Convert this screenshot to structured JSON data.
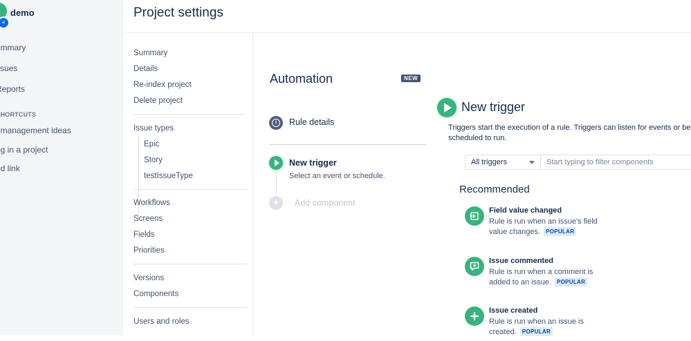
{
  "project": {
    "name": "demo"
  },
  "leftnav": {
    "items": [
      "Summary",
      "Issues",
      "Reports"
    ],
    "shortcuts_caption": "PROJECT SHORTCUTS",
    "shortcuts": [
      "Product management ideas",
      "Getting started in a project",
      "Add link"
    ],
    "visible_items": [
      "ummary",
      "ssues",
      "Reports"
    ],
    "visible_caption": "T SHORTCUTS",
    "visible_shortcuts": [
      "t management ideas",
      "ng in a project",
      "dd link"
    ]
  },
  "header": {
    "title": "Project settings"
  },
  "settings_nav": {
    "group1": [
      "Summary",
      "Details",
      "Re-index project",
      "Delete project"
    ],
    "issue_types_label": "Issue types",
    "issue_types": [
      "Epic",
      "Story",
      "testIssueType"
    ],
    "group3": [
      "Workflows",
      "Screens",
      "Fields",
      "Priorities"
    ],
    "group4": [
      "Versions",
      "Components"
    ],
    "group5": [
      "Users and roles"
    ]
  },
  "automation": {
    "title": "Automation",
    "badge": "NEW",
    "rule_details": "Rule details",
    "new_trigger_step": {
      "title": "New trigger",
      "desc": "Select an event or schedule."
    },
    "add_component": "Add component"
  },
  "trigger_panel": {
    "title": "New trigger",
    "description": "Triggers start the execution of a rule. Triggers can listen for events or be scheduled to run.",
    "filter_select": "All triggers",
    "filter_placeholder": "Start typing to filter components",
    "recommended_title": "Recommended",
    "items": [
      {
        "name": "Field value changed",
        "desc": "Rule is run when an issue's field value changes.",
        "badge": "POPULAR",
        "icon": "field-change-icon"
      },
      {
        "name": "Issue commented",
        "desc": "Rule is run when a comment is added to an issue.",
        "badge": "POPULAR",
        "icon": "comment-icon"
      },
      {
        "name": "Issue created",
        "desc": "Rule is run when an issue is created.",
        "badge": "POPULAR",
        "icon": "plus-icon"
      }
    ]
  },
  "colors": {
    "accent_green": "#36b37e",
    "badge_dark": "#42526e",
    "popular_bg": "#deebff"
  }
}
